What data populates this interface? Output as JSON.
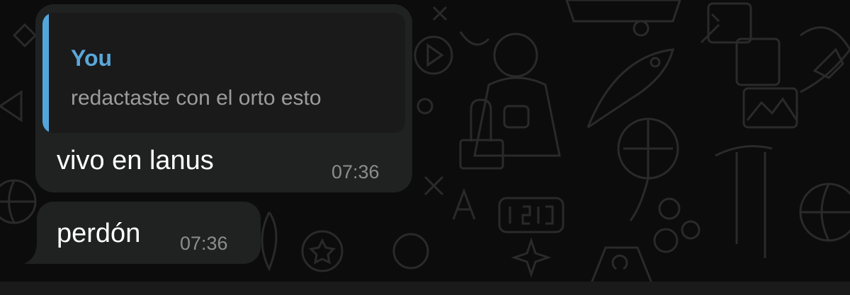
{
  "chat": {
    "messages": [
      {
        "quote": {
          "author": "You",
          "text": "redactaste con el orto esto"
        },
        "text": "vivo en lanus",
        "time": "07:36"
      },
      {
        "text": "perdón",
        "time": "07:36"
      }
    ]
  },
  "colors": {
    "background": "#0c0c0c",
    "bubble": "#202222",
    "quote_background": "#1a1a1a",
    "quote_accent": "#53a6dc",
    "quote_author": "#5aa7d9",
    "timestamp": "#8c8c8c"
  }
}
